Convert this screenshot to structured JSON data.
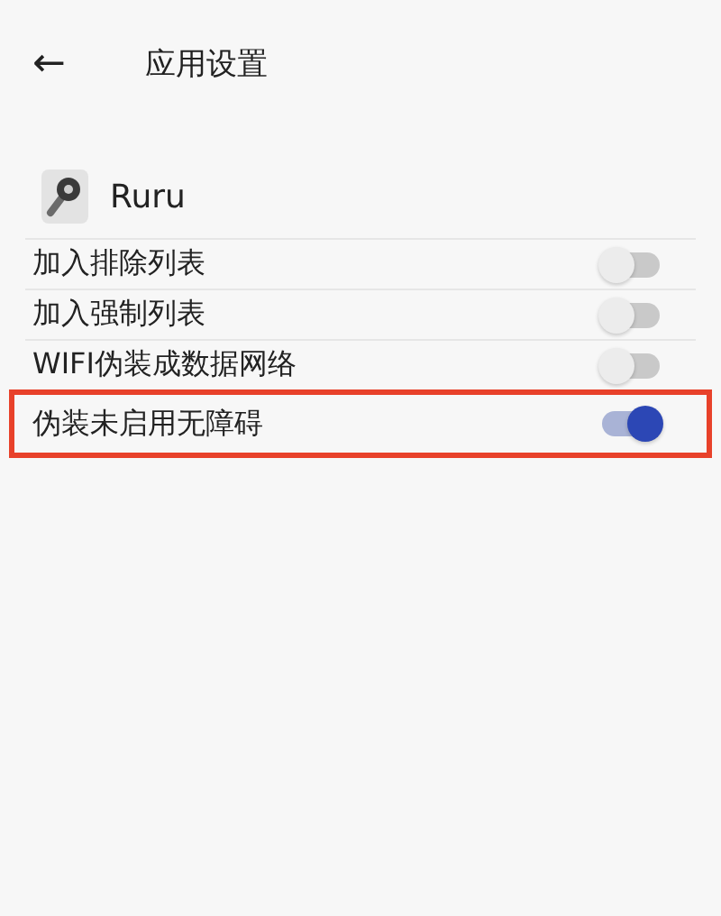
{
  "header": {
    "back": "←",
    "title": "应用设置"
  },
  "app": {
    "name": "Ruru"
  },
  "settings": [
    {
      "label": "加入排除列表",
      "on": false,
      "highlighted": false
    },
    {
      "label": "加入强制列表",
      "on": false,
      "highlighted": false
    },
    {
      "label": "WIFI伪装成数据网络",
      "on": false,
      "highlighted": false
    },
    {
      "label": "伪装未启用无障碍",
      "on": true,
      "highlighted": true
    }
  ]
}
